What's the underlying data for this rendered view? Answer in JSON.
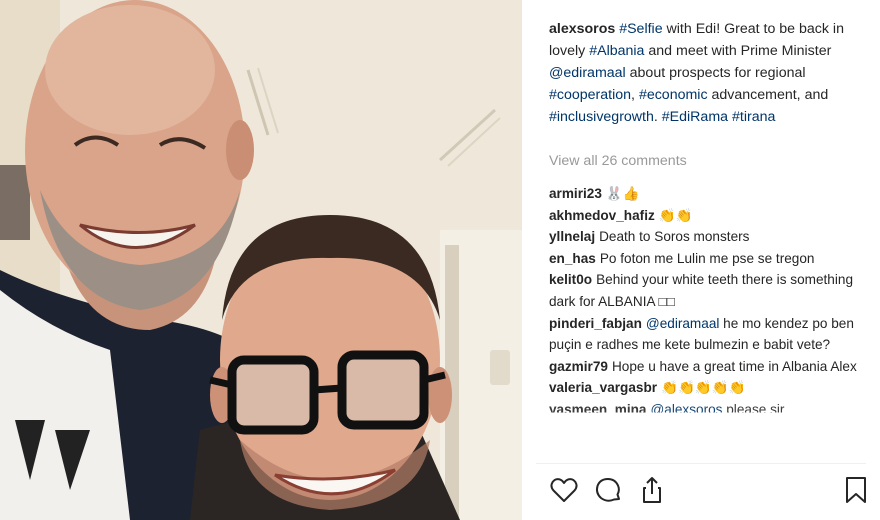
{
  "post": {
    "caption": {
      "username": "alexsoros",
      "parts": [
        {
          "text": "#Selfie",
          "tag": true
        },
        {
          "text": " with Edi! Great to be back in lovely ",
          "tag": false
        },
        {
          "text": "#Albania",
          "tag": true
        },
        {
          "text": " and meet with Prime Minister ",
          "tag": false
        },
        {
          "text": "@ediramaal",
          "tag": true
        },
        {
          "text": " about prospects for regional ",
          "tag": false
        },
        {
          "text": "#cooperation",
          "tag": true
        },
        {
          "text": ", ",
          "tag": false
        },
        {
          "text": "#economic",
          "tag": true
        },
        {
          "text": " advancement, and ",
          "tag": false
        },
        {
          "text": "#inclusivegrowth",
          "tag": true
        },
        {
          "text": ". ",
          "tag": false
        },
        {
          "text": "#EdiRama",
          "tag": true
        },
        {
          "text": " ",
          "tag": false
        },
        {
          "text": "#tirana",
          "tag": true
        }
      ]
    },
    "view_all_comments": "View all 26 comments",
    "comments": [
      {
        "user": "armiri23",
        "text": "🐰👍"
      },
      {
        "user": "akhmedov_hafiz",
        "text": "👏👏"
      },
      {
        "user": "yllnelaj",
        "text": "Death to Soros monsters"
      },
      {
        "user": "en_has",
        "text": "Po foton me Lulin me pse se tregon"
      },
      {
        "user": "kelit0o",
        "text": "Behind your white teeth there is something dark for ALBANIA □□"
      },
      {
        "user": "pinderi_fabjan",
        "mention": "@ediramaal",
        "text": " he mo kendez po ben puçin e radhes me kete bulmezin e babit vete?"
      },
      {
        "user": "gazmir79",
        "text": "Hope u have a great time in Albania Alex"
      },
      {
        "user": "valeria_vargasbr",
        "text": "👏👏👏👏👏"
      },
      {
        "user": "yasmeen_mina",
        "mention": "@alexsoros",
        "text": " please sir"
      }
    ],
    "actions": {
      "like_icon": "heart-icon",
      "comment_icon": "comment-icon",
      "share_icon": "share-icon",
      "save_icon": "bookmark-icon"
    },
    "colors": {
      "username": "#262626",
      "hashtag": "#003569",
      "muted": "#999999"
    }
  }
}
